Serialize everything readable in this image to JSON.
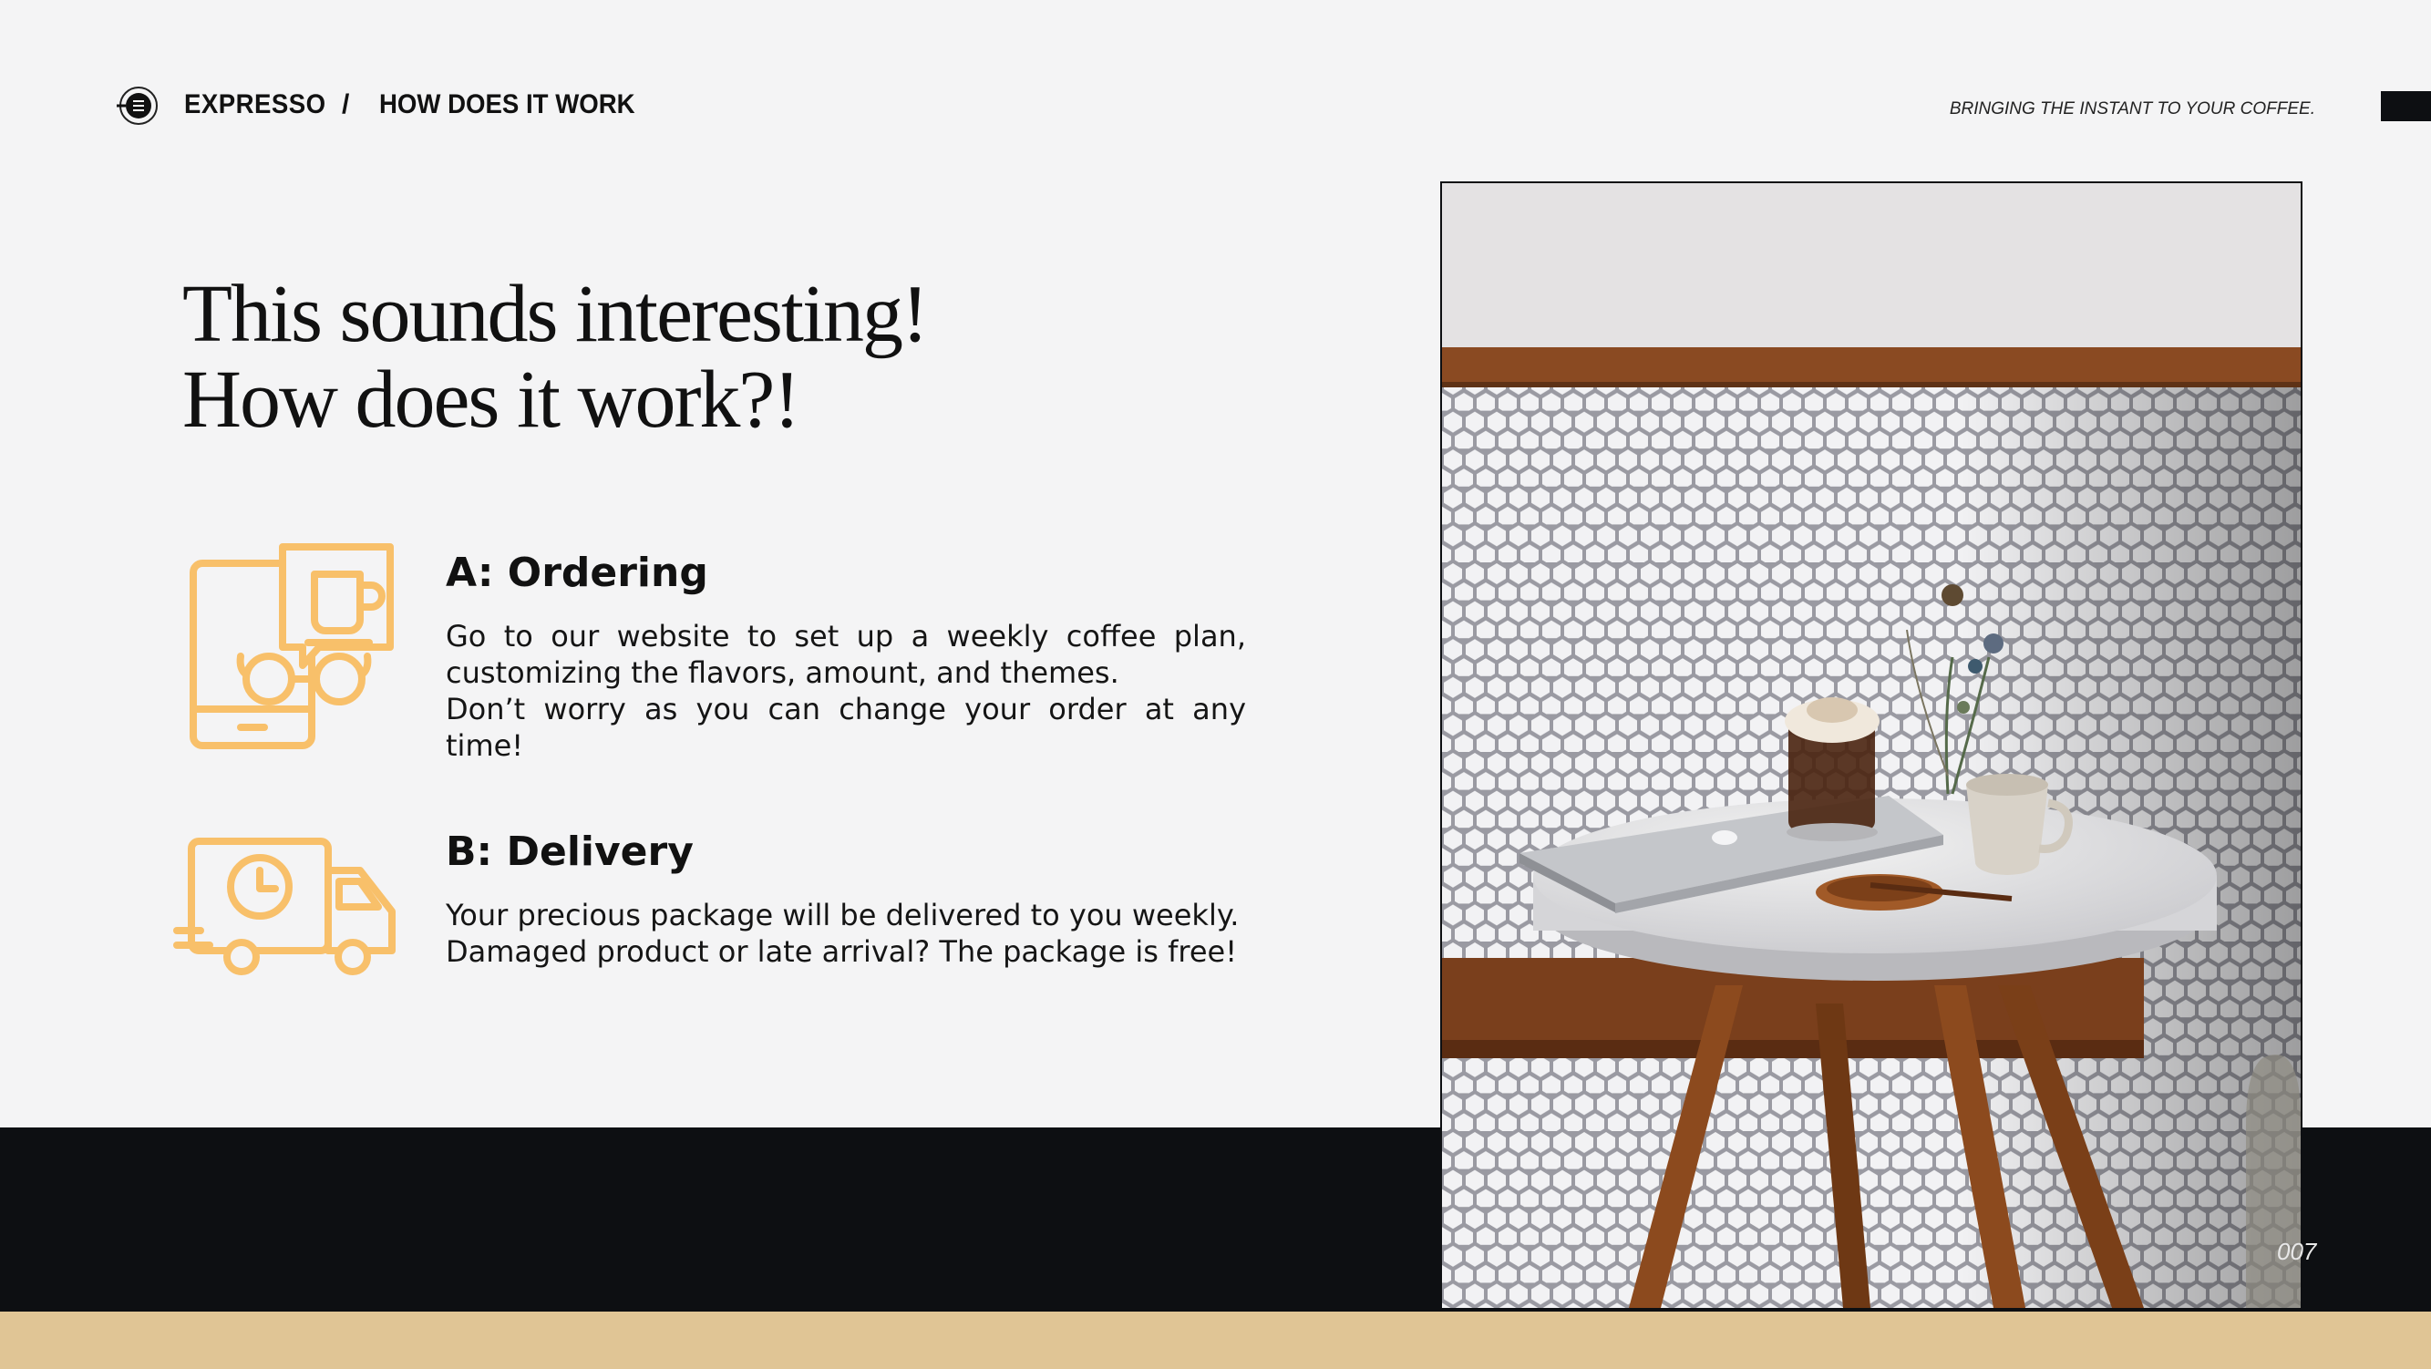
{
  "header": {
    "brand": "EXPRESSO",
    "separator": "/",
    "section": "HOW DOES IT WORK",
    "tagline": "BRINGING THE INSTANT TO YOUR COFFEE."
  },
  "heading": {
    "line1": "This sounds interesting!",
    "line2": "How does it work?!"
  },
  "features": [
    {
      "title": "A: Ordering",
      "lines": [
        "Go to our website to set up a weekly coffee plan,",
        "customizing the flavors, amount, and themes.",
        "Don’t worry as you can change your order at any time!"
      ],
      "icon": "phone-coffee-chat-icon"
    },
    {
      "title": "B: Delivery",
      "lines": [
        "Your precious package will be delivered to you weekly.",
        "Damaged product or late arrival? The package is free!"
      ],
      "icon": "delivery-truck-clock-icon"
    }
  ],
  "footer": {
    "page_number": "007"
  },
  "colors": {
    "background": "#f4f4f5",
    "dark": "#0d0f12",
    "accent": "#f8c06a",
    "tan": "#e0c595"
  }
}
